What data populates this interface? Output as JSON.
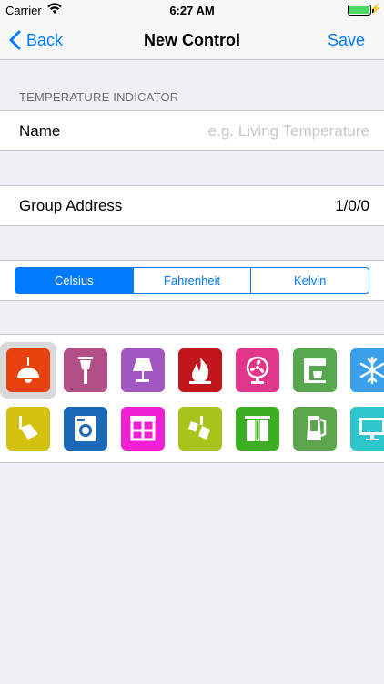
{
  "status": {
    "carrier": "Carrier",
    "time": "6:27 AM",
    "battery_level": 1.0
  },
  "nav": {
    "back_label": "Back",
    "title": "New Control",
    "save_label": "Save"
  },
  "section": {
    "header": "TEMPERATURE INDICATOR"
  },
  "name_field": {
    "label": "Name",
    "value": "",
    "placeholder": "e.g. Living Temperature"
  },
  "group_address": {
    "label": "Group Address",
    "value": "1/0/0"
  },
  "units": {
    "options": [
      "Celsius",
      "Fahrenheit",
      "Kelvin"
    ],
    "selected": "Celsius"
  },
  "icons": {
    "selected": "pendant-lamp-icon",
    "items": [
      {
        "name": "pendant-lamp-icon",
        "color": "#e8430f"
      },
      {
        "name": "street-lamp-icon",
        "color": "#b24f86"
      },
      {
        "name": "table-lamp-icon",
        "color": "#a156c0"
      },
      {
        "name": "fire-icon",
        "color": "#c0161c"
      },
      {
        "name": "fan-icon",
        "color": "#e0368c"
      },
      {
        "name": "coffee-machine-icon",
        "color": "#58a94e"
      },
      {
        "name": "snowflake-icon",
        "color": "#3aa0ea"
      },
      {
        "name": "spotlight-icon",
        "color": "#d2c10f"
      },
      {
        "name": "washing-machine-icon",
        "color": "#1b69b8"
      },
      {
        "name": "awning-icon",
        "color": "#f01fd4"
      },
      {
        "name": "spotlight-double-icon",
        "color": "#a5c51d"
      },
      {
        "name": "curtain-icon",
        "color": "#3dae23"
      },
      {
        "name": "kettle-icon",
        "color": "#5ba64a"
      },
      {
        "name": "monitor-icon",
        "color": "#2ec5cd"
      }
    ]
  }
}
